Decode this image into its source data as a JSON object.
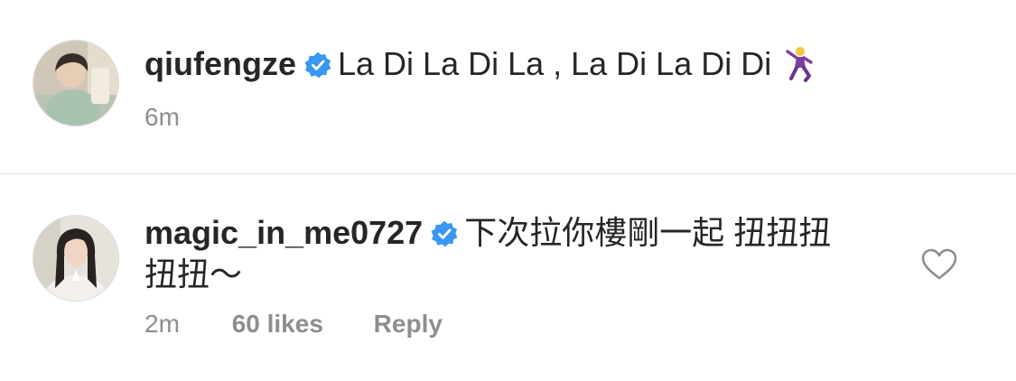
{
  "comments": [
    {
      "username": "qiufengze",
      "verified": true,
      "text": "La Di La Di La , La Di La Di Di",
      "emoji": "dancer-emoji",
      "time": "6m"
    },
    {
      "username": "magic_in_me0727",
      "verified": true,
      "text": "下次拉你樓剛一起 扭扭扭扭扭～",
      "time": "2m",
      "likes": "60 likes",
      "reply": "Reply",
      "heart_icon": "heart-outline-icon"
    }
  ],
  "colors": {
    "verified": "#3897f0",
    "meta": "#8e8e8e",
    "text": "#262626",
    "divider": "#dbdbdb"
  }
}
